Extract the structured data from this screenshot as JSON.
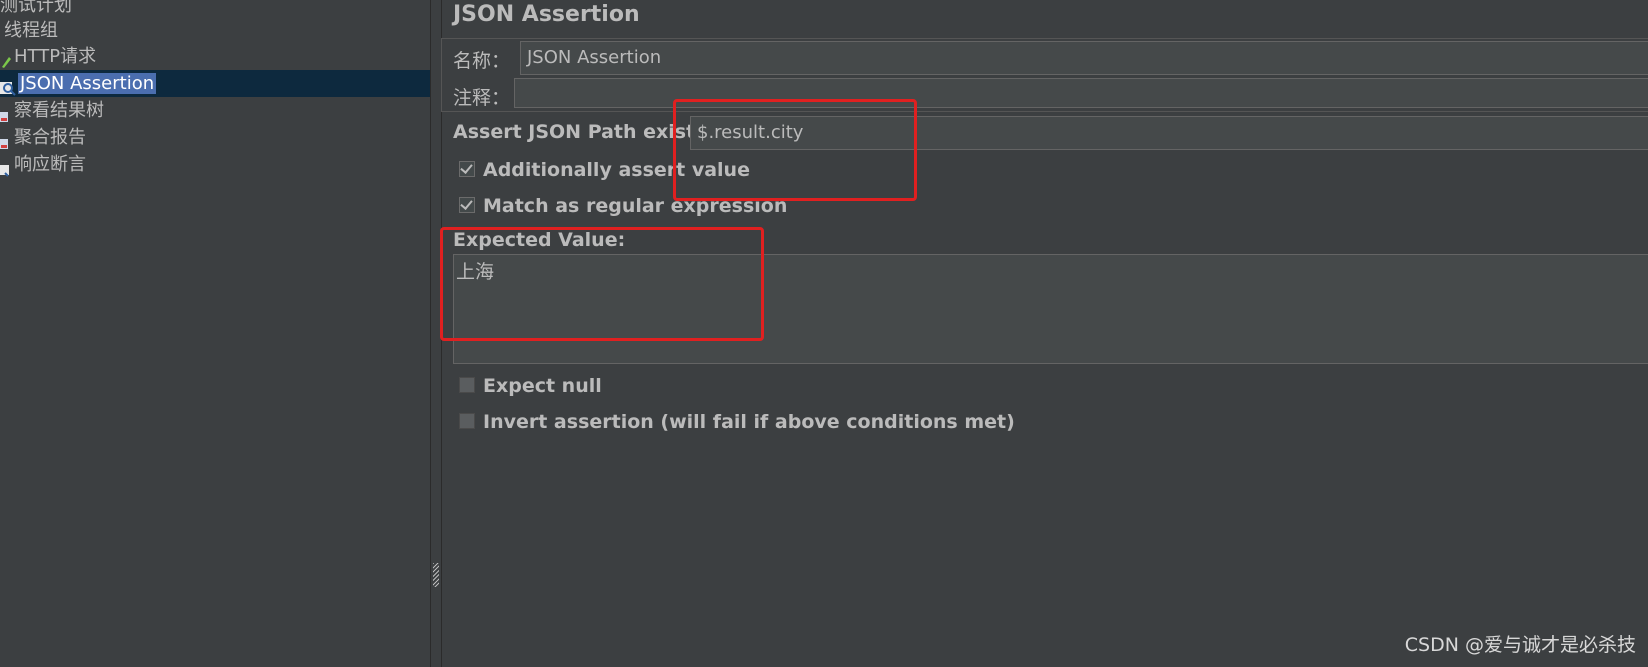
{
  "tree": {
    "items": [
      {
        "label": "测试计划",
        "icon": "test-plan-icon"
      },
      {
        "label": "线程组",
        "icon": "thread-group-icon"
      },
      {
        "label": "HTTP请求",
        "icon": "pencil-icon"
      },
      {
        "label": "JSON Assertion",
        "icon": "magnifier-icon",
        "selected": true
      },
      {
        "label": "察看结果树",
        "icon": "listener-icon"
      },
      {
        "label": "聚合报告",
        "icon": "listener-icon"
      },
      {
        "label": "响应断言",
        "icon": "assertion-icon"
      }
    ]
  },
  "panel": {
    "title": "JSON Assertion",
    "name_label": "名称：",
    "name_value": "JSON Assertion",
    "comment_label": "注释：",
    "comment_value": "",
    "json_path_label": "Assert JSON Path exists:",
    "json_path_value": "$.result.city",
    "additionally_assert_label": "Additionally assert value",
    "additionally_assert_checked": true,
    "match_regex_label": "Match as regular expression",
    "match_regex_checked": true,
    "expected_value_label": "Expected Value:",
    "expected_value": "上海",
    "expect_null_label": "Expect null",
    "expect_null_checked": false,
    "invert_label": "Invert assertion (will fail if above conditions met)",
    "invert_checked": false
  },
  "watermark": "CSDN @爱与诚才是必杀技",
  "colors": {
    "background": "#3c3f41",
    "selection": "#4b6eaf",
    "annotation_red": "#e02020"
  }
}
